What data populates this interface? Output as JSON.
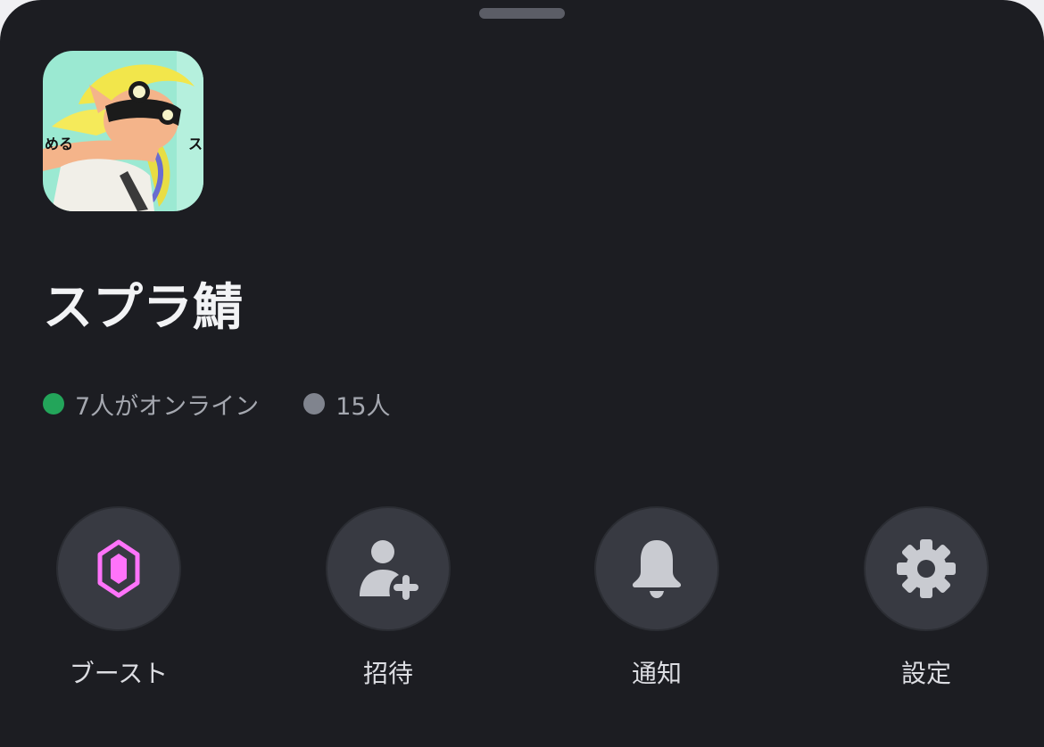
{
  "server": {
    "name": "スプラ鯖",
    "icon_caption_left": "める",
    "icon_caption_right": "ス"
  },
  "stats": {
    "online_text": "7人がオンライン",
    "members_text": "15人",
    "online_color": "#23a55a",
    "members_color": "#80848e"
  },
  "actions": [
    {
      "label": "ブースト",
      "icon": "boost-gem-icon",
      "color": "#ff73fa"
    },
    {
      "label": "招待",
      "icon": "add-user-icon",
      "color": "#c9cbd1"
    },
    {
      "label": "通知",
      "icon": "bell-icon",
      "color": "#c9cbd1"
    },
    {
      "label": "設定",
      "icon": "gear-icon",
      "color": "#c9cbd1"
    }
  ]
}
